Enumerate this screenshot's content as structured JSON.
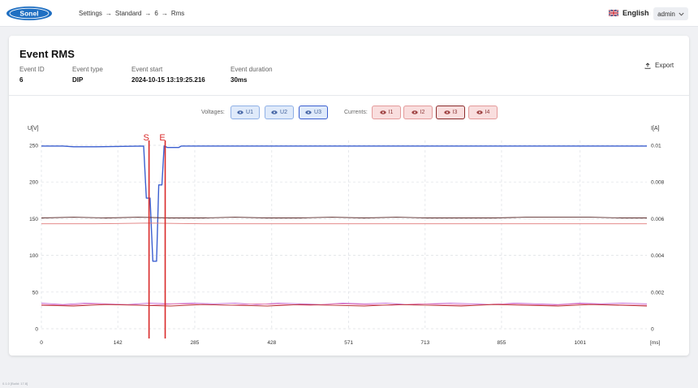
{
  "header": {
    "brand": "Sonel",
    "breadcrumb": [
      "Settings",
      "Standard",
      "6",
      "Rms"
    ],
    "language": "English",
    "user": "admin"
  },
  "event": {
    "title": "Event RMS",
    "fields": [
      {
        "label": "Event ID",
        "value": "6"
      },
      {
        "label": "Event type",
        "value": "DIP"
      },
      {
        "label": "Event start",
        "value": "2024-10-15 13:19:25.216"
      },
      {
        "label": "Event duration",
        "value": "30ms"
      }
    ],
    "export_label": "Export"
  },
  "legend": {
    "voltages_label": "Voltages:",
    "voltages": [
      "U1",
      "U2",
      "U3"
    ],
    "currents_label": "Currents:",
    "currents": [
      "I1",
      "I2",
      "I3",
      "I4"
    ]
  },
  "chart_data": {
    "type": "line",
    "y_left_label": "U[V]",
    "y_right_label": "I[A]",
    "x_unit": "[ms]",
    "x_ticks": [
      0,
      142,
      285,
      428,
      571,
      713,
      855,
      1001
    ],
    "y_left_ticks": [
      0,
      50,
      100,
      150,
      200,
      250
    ],
    "y_right_ticks": [
      "0",
      "0.002",
      "0.004",
      "0.006",
      "0.008",
      "0.01"
    ],
    "y_left_range": [
      0,
      250
    ],
    "y_right_range": [
      0,
      0.01
    ],
    "x_range": [
      0,
      1125
    ],
    "grid": true,
    "markers": [
      {
        "label": "S",
        "x": 200,
        "color": "#d92a2a"
      },
      {
        "label": "E",
        "x": 230,
        "color": "#d92a2a"
      }
    ],
    "series": [
      {
        "name": "U1",
        "axis": "left",
        "color": "#3b5fd0",
        "points": [
          [
            0,
            249
          ],
          [
            40,
            249
          ],
          [
            60,
            248
          ],
          [
            100,
            248
          ],
          [
            190,
            249
          ],
          [
            195,
            178
          ],
          [
            202,
            178
          ],
          [
            207,
            92
          ],
          [
            214,
            92
          ],
          [
            218,
            196
          ],
          [
            224,
            196
          ],
          [
            228,
            249
          ],
          [
            234,
            247
          ],
          [
            255,
            247
          ],
          [
            260,
            249
          ],
          [
            1125,
            249
          ]
        ]
      },
      {
        "name": "U2",
        "axis": "left",
        "color": "#5a2a2a",
        "points": [
          [
            0,
            151
          ],
          [
            60,
            152
          ],
          [
            120,
            151
          ],
          [
            180,
            152
          ],
          [
            240,
            151
          ],
          [
            300,
            151
          ],
          [
            360,
            152
          ],
          [
            420,
            151
          ],
          [
            480,
            151
          ],
          [
            540,
            152
          ],
          [
            600,
            151
          ],
          [
            660,
            152
          ],
          [
            720,
            151
          ],
          [
            780,
            151
          ],
          [
            840,
            151
          ],
          [
            900,
            152
          ],
          [
            960,
            152
          ],
          [
            1020,
            152
          ],
          [
            1080,
            151
          ],
          [
            1125,
            151
          ]
        ]
      },
      {
        "name": "U3",
        "axis": "left",
        "color": "#e07a7a",
        "points": [
          [
            0,
            143
          ],
          [
            100,
            143
          ],
          [
            200,
            144
          ],
          [
            300,
            143
          ],
          [
            400,
            143
          ],
          [
            500,
            143
          ],
          [
            600,
            143
          ],
          [
            700,
            143
          ],
          [
            800,
            143
          ],
          [
            900,
            143
          ],
          [
            1000,
            143
          ],
          [
            1125,
            143
          ]
        ]
      },
      {
        "name": "I1",
        "axis": "left",
        "color": "#c46ad8",
        "points": [
          [
            0,
            35
          ],
          [
            40,
            33
          ],
          [
            80,
            35
          ],
          [
            120,
            34
          ],
          [
            160,
            33
          ],
          [
            200,
            35
          ],
          [
            240,
            34
          ],
          [
            280,
            35
          ],
          [
            320,
            34
          ],
          [
            360,
            35
          ],
          [
            400,
            33
          ],
          [
            440,
            35
          ],
          [
            480,
            34
          ],
          [
            520,
            33
          ],
          [
            560,
            35
          ],
          [
            600,
            34
          ],
          [
            640,
            35
          ],
          [
            680,
            33
          ],
          [
            720,
            34
          ],
          [
            760,
            35
          ],
          [
            800,
            34
          ],
          [
            840,
            33
          ],
          [
            880,
            35
          ],
          [
            920,
            34
          ],
          [
            960,
            33
          ],
          [
            1000,
            35
          ],
          [
            1040,
            34
          ],
          [
            1080,
            35
          ],
          [
            1125,
            34
          ]
        ]
      },
      {
        "name": "I2",
        "axis": "left",
        "color": "#e87fb0",
        "points": [
          [
            0,
            33
          ],
          [
            50,
            32
          ],
          [
            100,
            34
          ],
          [
            150,
            33
          ],
          [
            200,
            32
          ],
          [
            250,
            34
          ],
          [
            300,
            33
          ],
          [
            350,
            32
          ],
          [
            400,
            34
          ],
          [
            450,
            33
          ],
          [
            500,
            32
          ],
          [
            550,
            34
          ],
          [
            600,
            33
          ],
          [
            650,
            32
          ],
          [
            700,
            34
          ],
          [
            750,
            33
          ],
          [
            800,
            32
          ],
          [
            850,
            34
          ],
          [
            900,
            33
          ],
          [
            950,
            32
          ],
          [
            1000,
            34
          ],
          [
            1050,
            33
          ],
          [
            1125,
            32
          ]
        ]
      },
      {
        "name": "I3",
        "axis": "left",
        "color": "#b83030",
        "points": [
          [
            0,
            32
          ],
          [
            60,
            31
          ],
          [
            120,
            33
          ],
          [
            180,
            32
          ],
          [
            240,
            31
          ],
          [
            300,
            33
          ],
          [
            360,
            32
          ],
          [
            420,
            31
          ],
          [
            480,
            33
          ],
          [
            540,
            32
          ],
          [
            600,
            31
          ],
          [
            660,
            33
          ],
          [
            720,
            32
          ],
          [
            780,
            31
          ],
          [
            840,
            33
          ],
          [
            900,
            32
          ],
          [
            960,
            31
          ],
          [
            1020,
            33
          ],
          [
            1080,
            32
          ],
          [
            1125,
            31
          ]
        ]
      }
    ]
  },
  "footer": {
    "version": "0.1.0 [Build: 17.8]"
  }
}
